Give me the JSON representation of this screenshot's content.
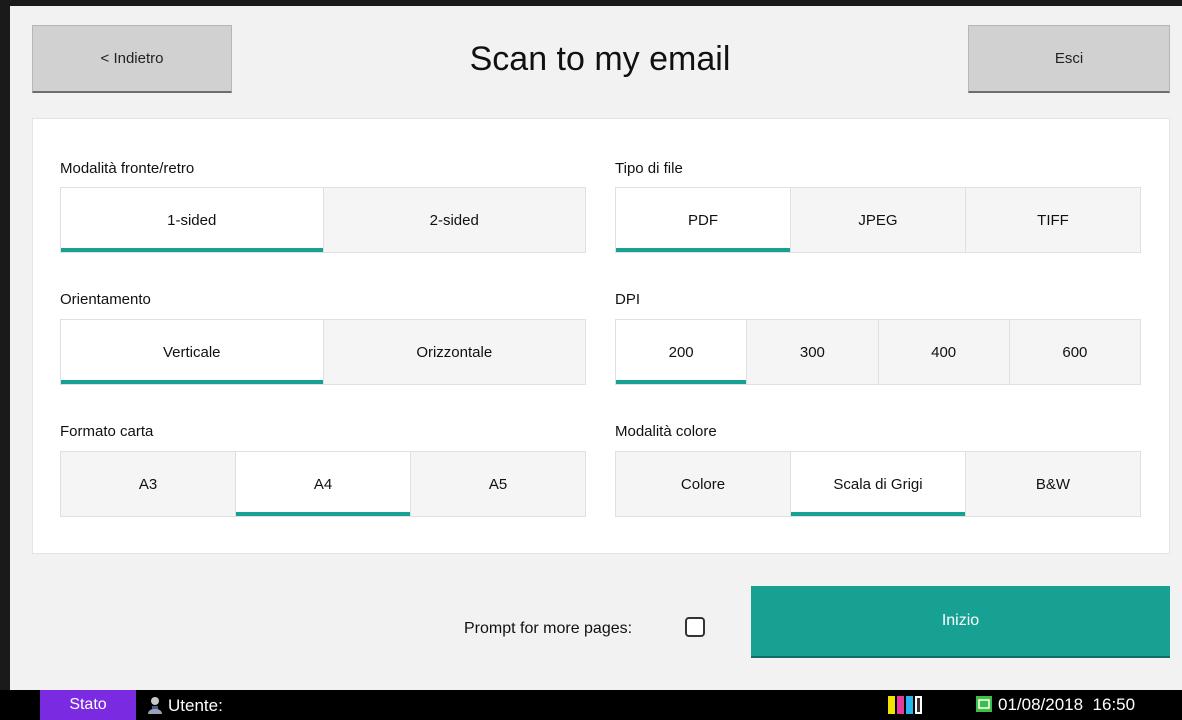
{
  "header": {
    "back_label": "< Indietro",
    "title": "Scan to my email",
    "exit_label": "Esci"
  },
  "settings": {
    "duplex": {
      "label": "Modalità fronte/retro",
      "options": [
        "1-sided",
        "2-sided"
      ],
      "selected": "1-sided"
    },
    "orientation": {
      "label": "Orientamento",
      "options": [
        "Verticale",
        "Orizzontale"
      ],
      "selected": "Verticale"
    },
    "paper": {
      "label": "Formato carta",
      "options": [
        "A3",
        "A4",
        "A5"
      ],
      "selected": "A4"
    },
    "file_type": {
      "label": "Tipo di file",
      "options": [
        "PDF",
        "JPEG",
        "TIFF"
      ],
      "selected": "PDF"
    },
    "dpi": {
      "label": "DPI",
      "options": [
        "200",
        "300",
        "400",
        "600"
      ],
      "selected": "200"
    },
    "color_mode": {
      "label": "Modalità colore",
      "options": [
        "Colore",
        "Scala di Grigi",
        "B&W"
      ],
      "selected": "Scala di Grigi"
    }
  },
  "footer": {
    "prompt_label": "Prompt for more pages:",
    "prompt_checked": false,
    "start_label": "Inizio"
  },
  "statusbar": {
    "stato_label": "Stato",
    "user_label": "Utente:",
    "date": "01/08/2018",
    "time": "16:50",
    "icons": {
      "user": "user-icon",
      "toner": "toner-icon",
      "clock": "clock-icon"
    }
  },
  "colors": {
    "accent": "#17a193",
    "stato": "#7a2ae0"
  }
}
